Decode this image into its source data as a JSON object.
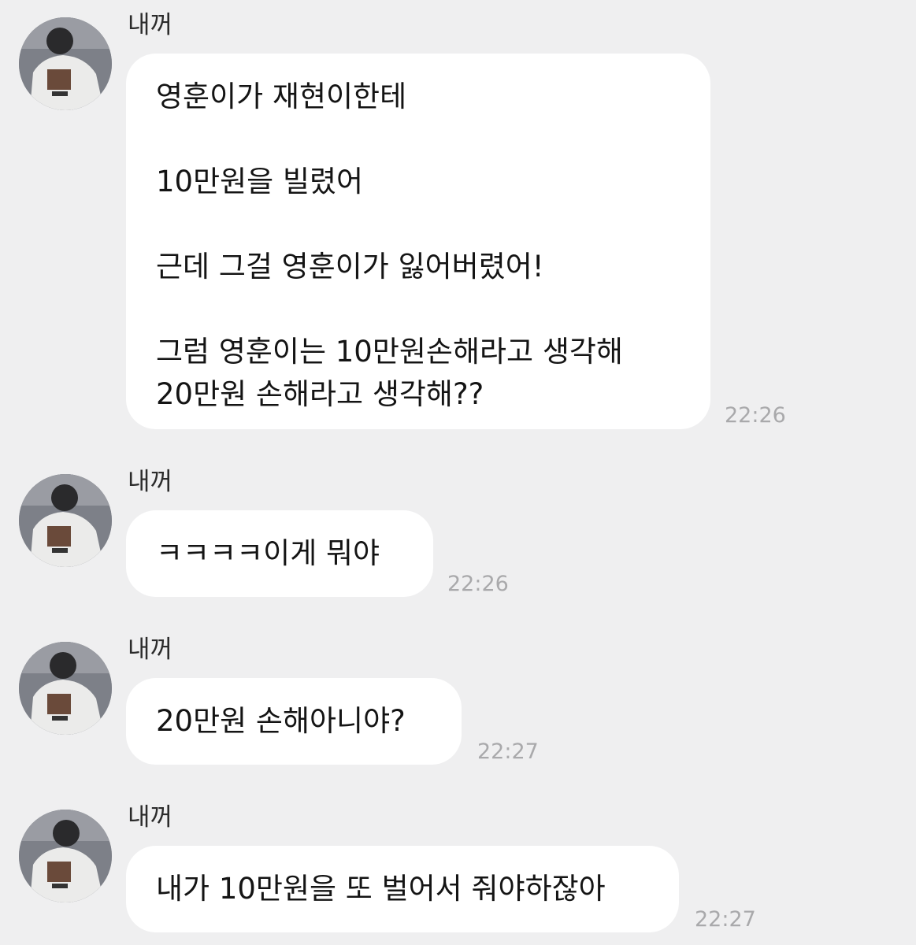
{
  "messages": [
    {
      "sender": "내꺼",
      "lines": [
        "영훈이가 재현이한테",
        "",
        "10만원을 빌렸어",
        "",
        "근데 그걸 영훈이가 잃어버렸어!",
        "",
        "그럼 영훈이는 10만원손해라고 생각해",
        "20만원 손해라고 생각해??"
      ],
      "time": "22:26"
    },
    {
      "sender": "내꺼",
      "lines": [
        "ㅋㅋㅋㅋ이게 뭐야"
      ],
      "time": "22:26"
    },
    {
      "sender": "내꺼",
      "lines": [
        "20만원 손해아니야?"
      ],
      "time": "22:27"
    },
    {
      "sender": "내꺼",
      "lines": [
        "내가 10만원을 또 벌어서 줘야하잖아"
      ],
      "time": "22:27"
    }
  ]
}
